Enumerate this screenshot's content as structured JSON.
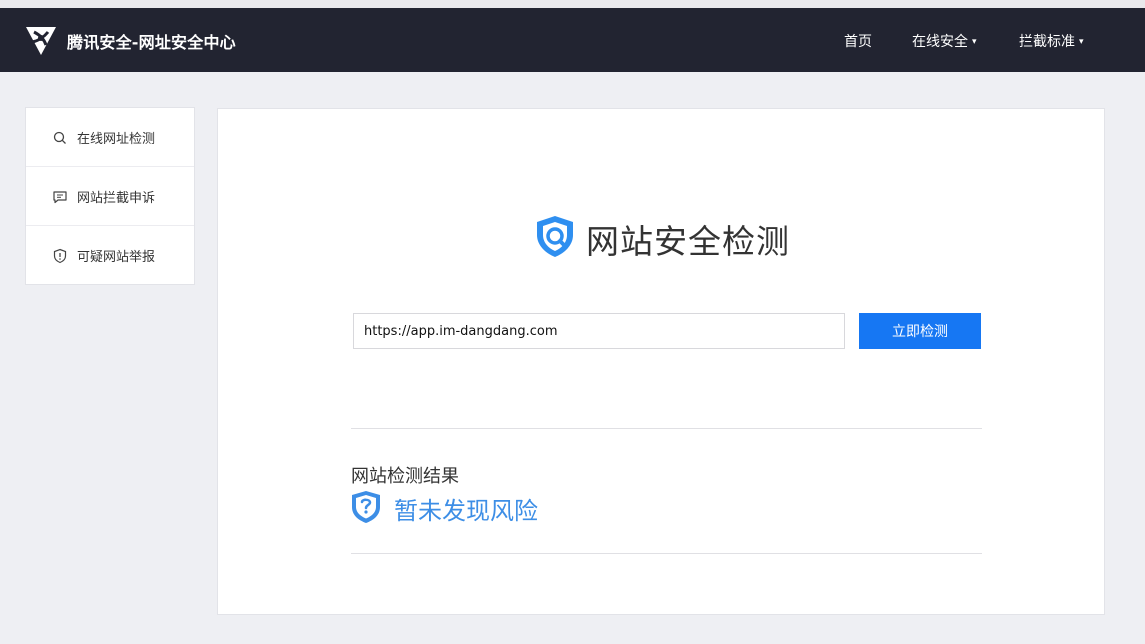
{
  "header": {
    "brand": "腾讯安全-网址安全中心",
    "nav": [
      {
        "label": "首页",
        "has_dropdown": false
      },
      {
        "label": "在线安全",
        "has_dropdown": true
      },
      {
        "label": "拦截标准",
        "has_dropdown": true
      }
    ],
    "caret": "▾",
    "logo_icon": "tencent-security-logo"
  },
  "sidebar": {
    "items": [
      {
        "label": "在线网址检测",
        "icon": "search-icon"
      },
      {
        "label": "网站拦截申诉",
        "icon": "message-icon"
      },
      {
        "label": "可疑网站举报",
        "icon": "shield-alert-icon"
      }
    ]
  },
  "main": {
    "title": "网站安全检测",
    "title_icon": "shield-search-icon",
    "url_input": {
      "value": "https://app.im-dangdang.com"
    },
    "check_button": "立即检测",
    "result": {
      "title": "网站检测结果",
      "status": "暂未发现风险",
      "status_icon": "shield-question-icon",
      "status_color": "#3d8ee6"
    }
  },
  "colors": {
    "header_bg": "#222431",
    "accent": "#1677f3",
    "page_bg": "#eeeff3"
  }
}
